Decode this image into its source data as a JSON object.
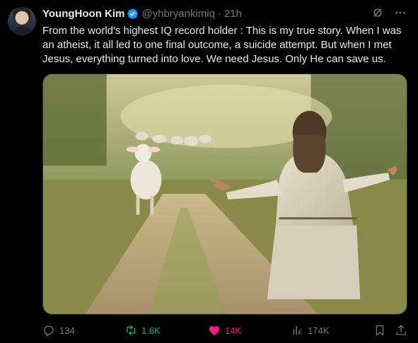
{
  "author": {
    "name": "YoungHoon Kim",
    "handle": "@yhbryankimiq",
    "separator": "·",
    "time": "21h"
  },
  "tweet": {
    "text": "From the world's highest IQ record holder : This is my true story. When I was an atheist, it all led to one final outcome, a suicide attempt. But when I met Jesus, everything turned into love. We need Jesus. Only He can save us."
  },
  "actions": {
    "replies": "134",
    "reposts": "1.6K",
    "likes": "14K",
    "views": "174K"
  },
  "colors": {
    "background": "#000000",
    "text": "#e7e9ea",
    "muted": "#71767b",
    "verified": "#1d9bf0",
    "repost_active": "#00ba7c",
    "like_active": "#f91880"
  },
  "icons": {
    "verified": "verified-badge-icon",
    "grok": "grok-icon",
    "more": "more-dots-icon",
    "reply": "reply-icon",
    "repost": "repost-icon",
    "like": "heart-icon",
    "views": "views-icon",
    "bookmark": "bookmark-icon",
    "share": "share-icon"
  }
}
